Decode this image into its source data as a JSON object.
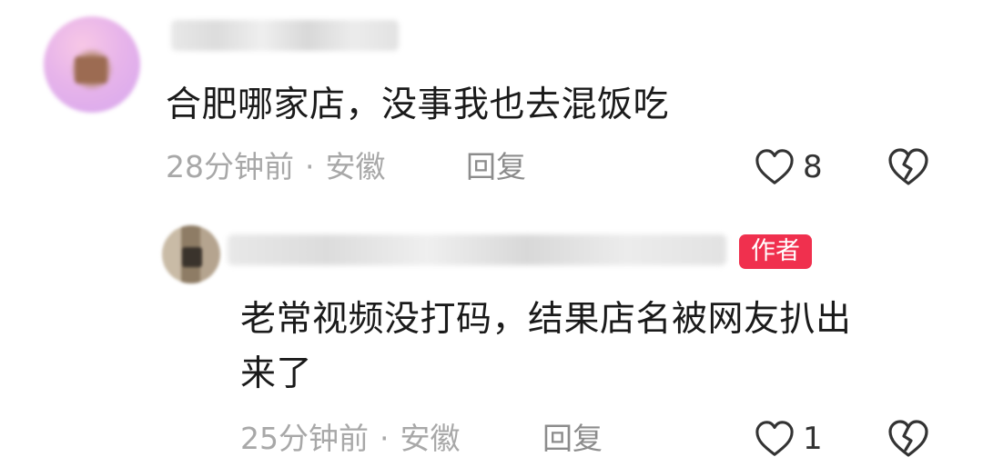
{
  "comments": [
    {
      "text": "合肥哪家店，没事我也去混饭吃",
      "time": "28分钟前",
      "separator": "·",
      "location": "安徽",
      "reply_label": "回复",
      "likes": "8"
    },
    {
      "badge": "作者",
      "text_line1": "老常视频没打码，结果店名被网友扒出",
      "text_line2": "来了",
      "time": "25分钟前",
      "separator": "·",
      "location": "安徽",
      "reply_label": "回复",
      "likes": "1"
    }
  ],
  "icons": {
    "like": "heart-outline-icon",
    "dislike": "broken-heart-outline-icon"
  },
  "colors": {
    "badge_bg": "#f0304e",
    "meta_text": "#a8a8a8",
    "body_text": "#1a1a1a"
  }
}
